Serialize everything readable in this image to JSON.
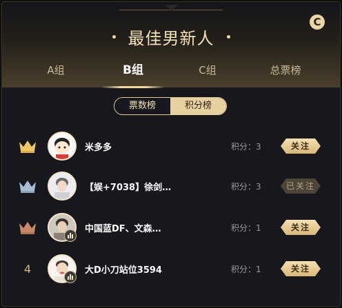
{
  "title": "最佳男新人",
  "tabs": [
    {
      "label": "A组",
      "active": false
    },
    {
      "label": "B组",
      "active": true
    },
    {
      "label": "C组",
      "active": false
    },
    {
      "label": "总票榜",
      "active": false
    }
  ],
  "subtabs": [
    {
      "label": "票数榜",
      "active": true
    },
    {
      "label": "积分榜",
      "active": false
    }
  ],
  "colors": {
    "accent": "#f3e1b6",
    "gold_crown": "#f0c660",
    "silver_crown": "#a9bcd3",
    "bronze_crown": "#c8896a"
  },
  "rows": [
    {
      "rank_icon": "gold-crown-icon",
      "rank_text": "",
      "name": "米多多",
      "score": "积分：3",
      "follow": "关注",
      "followed": false,
      "badge": false
    },
    {
      "rank_icon": "silver-crown-icon",
      "rank_text": "",
      "name": "【娱+7038】徐剑…",
      "score": "积分：3",
      "follow": "已关注",
      "followed": true,
      "badge": false
    },
    {
      "rank_icon": "bronze-crown-icon",
      "rank_text": "",
      "name": "中国蓝DF、文森…",
      "score": "积分：1",
      "follow": "关注",
      "followed": false,
      "badge": true
    },
    {
      "rank_icon": "",
      "rank_text": "4",
      "name": "大D小刀站位3594",
      "score": "积分：1",
      "follow": "关注",
      "followed": false,
      "badge": true
    }
  ]
}
